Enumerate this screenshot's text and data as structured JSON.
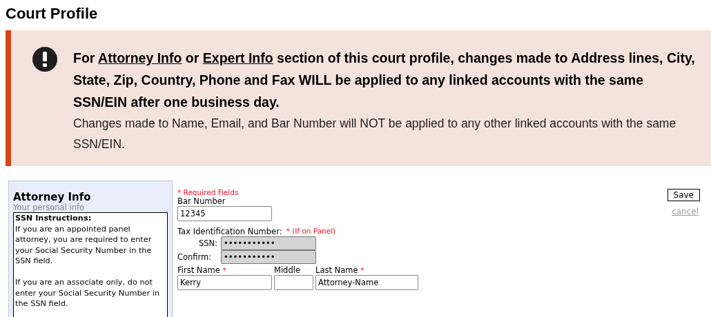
{
  "page_title": "Court Profile",
  "notice": {
    "segments": [
      {
        "kind": "text",
        "text": "For "
      },
      {
        "kind": "link",
        "text": "Attorney Info"
      },
      {
        "kind": "text",
        "text": " or "
      },
      {
        "kind": "link",
        "text": "Expert Info"
      },
      {
        "kind": "text",
        "text": " section of this court profile, changes made to Address lines, City, State, Zip, Country, Phone and Fax WILL be applied to any linked accounts with the same SSN/EIN after one business day."
      }
    ],
    "note": "Changes made to Name, Email, and Bar Number will NOT be applied to any other linked accounts with the same SSN/EIN."
  },
  "sidebar": {
    "title": "Attorney Info",
    "subtitle": "Your personal info",
    "instructions": {
      "heading": "SSN Instructions:",
      "paragraphs": [
        "If you are an appointed panel attorney, you are required to enter your Social Security Number in the SSN field.",
        "If you are an associate only, do not enter your Social Security Number in the SSN field."
      ]
    }
  },
  "form": {
    "required_mark": "*",
    "required_note": "* Required Fields",
    "bar_number": {
      "label": "Bar Number",
      "value": "12345"
    },
    "tax_id": {
      "label": "Tax Identification Number:",
      "note": "* (If on Panel)",
      "fields": [
        {
          "label": "SSN:",
          "value": "•••••••••••",
          "disabled": true
        },
        {
          "label": "Confirm:",
          "value": "•••••••••••",
          "disabled": true
        }
      ]
    },
    "name_fields": [
      {
        "label": "First Name",
        "required": true,
        "value": "Kerry"
      },
      {
        "label": "Middle",
        "required": false
      },
      {
        "label": "Last Name",
        "required": true,
        "value": "Attorney-Name"
      }
    ]
  },
  "actions": {
    "save": "Save",
    "cancel": "cancel"
  }
}
